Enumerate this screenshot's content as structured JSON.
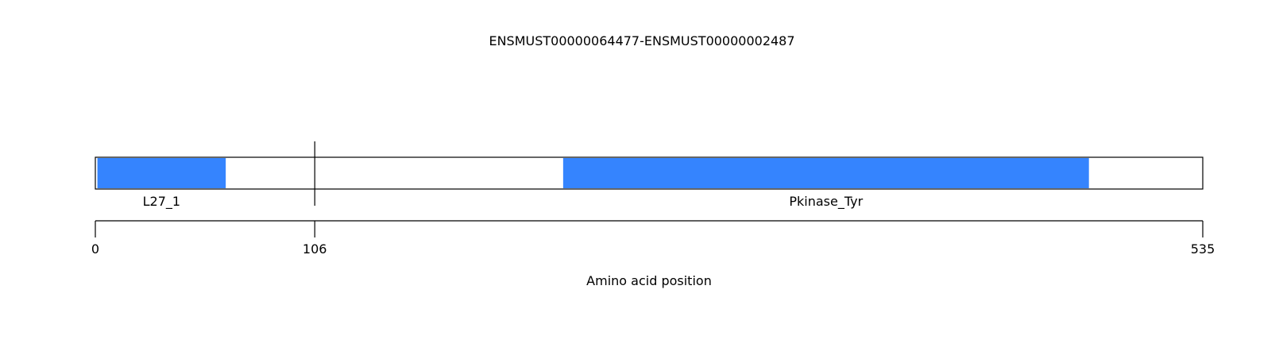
{
  "title": "ENSMUST00000064477-ENSMUST00000002487",
  "xlabel": "Amino acid position",
  "protein_length": 535,
  "breakpoint": 106,
  "domain_color": "#3584fe",
  "domains": [
    {
      "name": "L27_1",
      "start": 1,
      "end": 63
    },
    {
      "name": "Pkinase_Tyr",
      "start": 226,
      "end": 480
    }
  ],
  "ticks": [
    {
      "value": 0,
      "label": "0"
    },
    {
      "value": 106,
      "label": "106"
    },
    {
      "value": 535,
      "label": "535"
    }
  ],
  "chart_data": {
    "type": "diagram",
    "title": "ENSMUST00000064477-ENSMUST00000002487",
    "xlabel": "Amino acid position",
    "xlim": [
      0,
      535
    ],
    "breakpoint": 106,
    "domains": [
      {
        "name": "L27_1",
        "start": 1,
        "end": 63
      },
      {
        "name": "Pkinase_Tyr",
        "start": 226,
        "end": 480
      }
    ]
  }
}
